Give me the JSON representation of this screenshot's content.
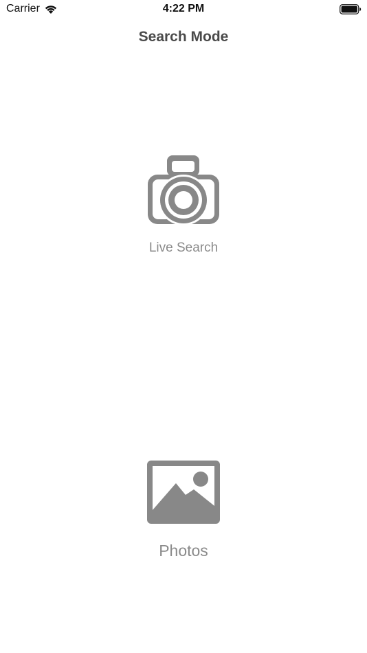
{
  "status_bar": {
    "carrier": "Carrier",
    "time": "4:22 PM",
    "icons": [
      "wifi-icon",
      "battery-icon"
    ]
  },
  "nav": {
    "title": "Search Mode"
  },
  "modes": [
    {
      "label": "Live Search",
      "icon": "camera-icon"
    },
    {
      "label": "Photos",
      "icon": "photo-icon"
    }
  ],
  "colors": {
    "icon_gray": "#888888",
    "label_gray": "#8a8a8a",
    "title_gray": "#4a4a4a",
    "background": "#ffffff"
  }
}
